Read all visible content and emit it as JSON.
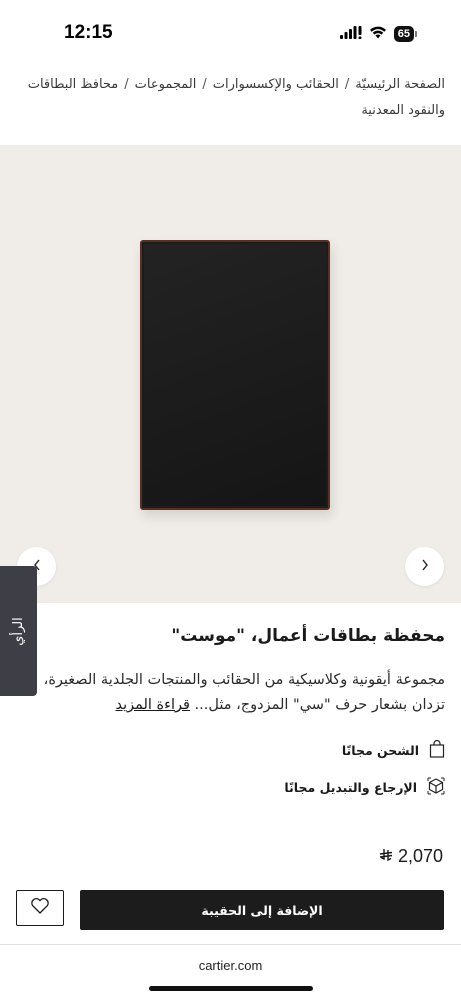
{
  "status_bar": {
    "time": "12:15",
    "battery": "65",
    "icons": [
      "signal-icon",
      "wifi-icon",
      "battery-icon"
    ]
  },
  "breadcrumb": {
    "items": [
      "الصفحة الرئيسيّة",
      "الحقائب والإكسسوارات",
      "المجموعات",
      "محافظ البطاقات والنقود المعدنية"
    ],
    "separator": "/"
  },
  "carousel": {
    "prev_icon": "chevron-left-icon",
    "next_icon": "chevron-right-icon"
  },
  "feedback_tab": {
    "label": "الرأي"
  },
  "product": {
    "title": "محفظة بطاقات أعمال، \"موست\"",
    "description": "مجموعة أيقونية وكلاسيكية من الحقائب والمنتجات الجلدية الصغيرة، تزدان بشعار حرف \"سي\" المزدوج، مثل...",
    "read_more": "قراءة المزيد",
    "price": "2,070",
    "currency_icon": "saudi-riyal-icon"
  },
  "services": {
    "shipping": "الشحن مجانًا",
    "returns": "الإرجاع والتبديل مجانًا"
  },
  "actions": {
    "add_to_bag": "الإضافة إلى الحقيبة",
    "wishlist_icon": "heart-icon"
  },
  "browser": {
    "url": "cartier.com"
  },
  "colors": {
    "background": "#ffffff",
    "image_background": "#f0ede8",
    "primary_button": "#1c1c1c",
    "feedback_tab": "#3e3e46",
    "wallet_edge": "#5a2e22"
  }
}
